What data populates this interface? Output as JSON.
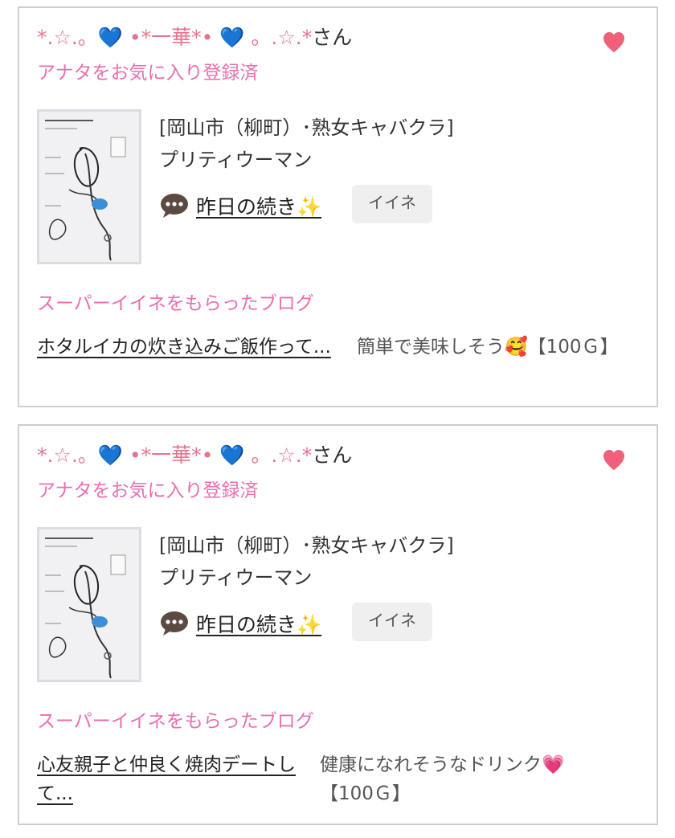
{
  "colors": {
    "accent_pink": "#e96fb0",
    "name_pink": "#e8738e",
    "heart": "#f0607a",
    "card_border": "#cfcfcf",
    "iine_bg": "#efefef"
  },
  "cards": [
    {
      "user_name": "*.☆.。💙 •*一華*• 💙 。.☆.*",
      "user_suffix": "さん",
      "favorite_status": "アナタをお気に入り登録済",
      "favorite_icon": "heart-icon",
      "shop_area": "[岡山市（柳町）･熟女キャバクラ]",
      "shop_name": "プリティウーマン",
      "blog_title": "昨日の続き✨",
      "iine_label": "イイネ",
      "super_iine_label": "スーパーイイネをもらったブログ",
      "post_title": "ホタルイカの炊き込みご飯作って...",
      "post_comment": "簡単で美味しそう🥰【100Ｇ】"
    },
    {
      "user_name": "*.☆.。💙 •*一華*• 💙 。.☆.*",
      "user_suffix": "さん",
      "favorite_status": "アナタをお気に入り登録済",
      "favorite_icon": "heart-icon",
      "shop_area": "[岡山市（柳町）･熟女キャバクラ]",
      "shop_name": "プリティウーマン",
      "blog_title": "昨日の続き✨",
      "iine_label": "イイネ",
      "super_iine_label": "スーパーイイネをもらったブログ",
      "post_title": "心友親子と仲良く焼肉デートして...",
      "post_comment": "健康になれそうなドリンク💗【100Ｇ】"
    }
  ]
}
